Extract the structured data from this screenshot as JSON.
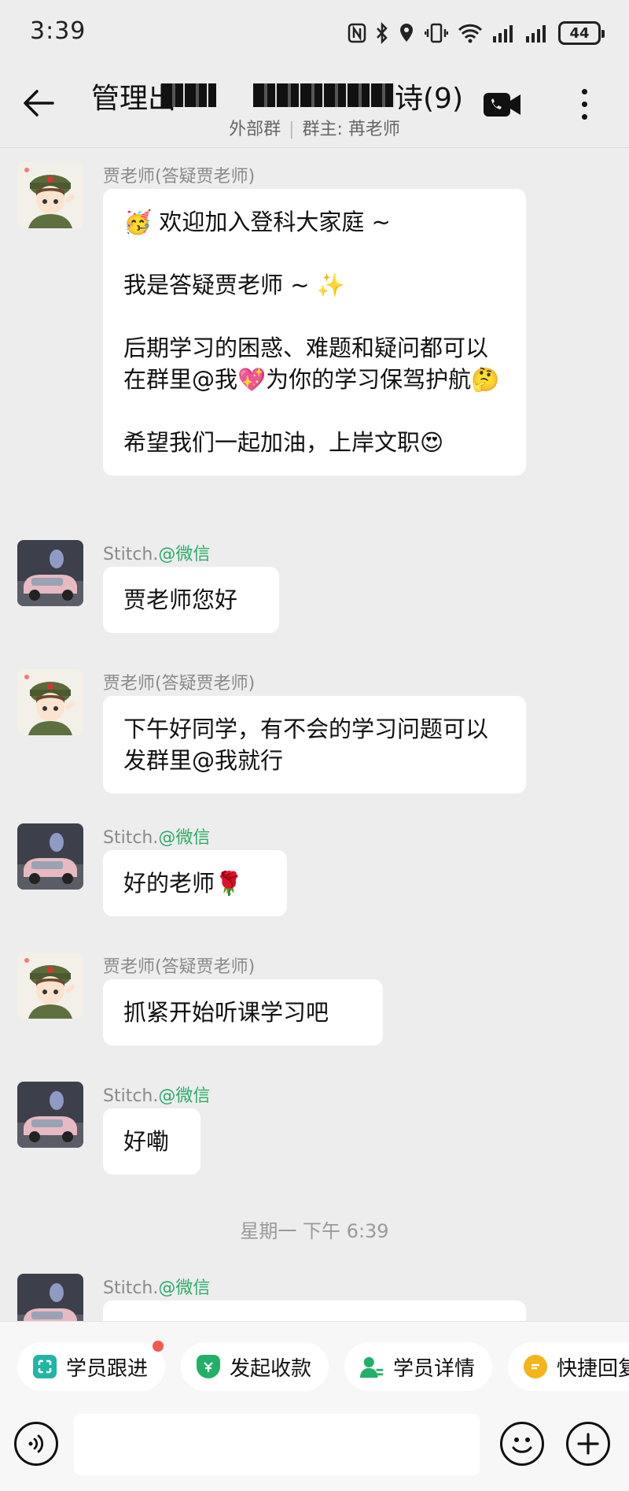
{
  "status_bar": {
    "time": "3:39",
    "battery": "44"
  },
  "header": {
    "title_prefix": "管理出",
    "title_suffix": "诗(9)",
    "subtitle_group_type": "外部群",
    "subtitle_owner": "群主: 苒老师"
  },
  "messages": [
    {
      "sender": "贾老师(答疑贾老师)",
      "tag": "",
      "avatar": "teacher",
      "paragraphs": [
        "🥳 欢迎加入登科大家庭 ~",
        "我是答疑贾老师 ~ ✨",
        "后期学习的困惑、难题和疑问都可以在群里@我💖为你的学习保驾护航🤔",
        "希望我们一起加油，上岸文职😍"
      ]
    },
    {
      "sender": "Stitch.",
      "tag": "@微信",
      "avatar": "student",
      "paragraphs": [
        "贾老师您好"
      ]
    },
    {
      "sender": "贾老师(答疑贾老师)",
      "tag": "",
      "avatar": "teacher",
      "paragraphs": [
        "下午好同学，有不会的学习问题可以发群里@我就行"
      ]
    },
    {
      "sender": "Stitch.",
      "tag": "@微信",
      "avatar": "student",
      "paragraphs": [
        "好的老师🌹"
      ]
    },
    {
      "sender": "贾老师(答疑贾老师)",
      "tag": "",
      "avatar": "teacher",
      "paragraphs": [
        "抓紧开始听课学习吧"
      ]
    },
    {
      "sender": "Stitch.",
      "tag": "@微信",
      "avatar": "student",
      "paragraphs": [
        "好嘞"
      ]
    },
    {
      "sender": "Stitch.",
      "tag": "@微信",
      "avatar": "student",
      "paragraphs": [
        ""
      ]
    }
  ],
  "timestamp": "星期一 下午 6:39",
  "quick_actions": [
    {
      "label": "学员跟进",
      "icon": "follow-up-icon",
      "color": "#22b5a6",
      "badge": true
    },
    {
      "label": "发起收款",
      "icon": "payment-shield-icon",
      "color": "#22b069",
      "badge": false
    },
    {
      "label": "学员详情",
      "icon": "user-detail-icon",
      "color": "#22b069",
      "badge": false
    },
    {
      "label": "快捷回复",
      "icon": "quick-reply-icon",
      "color": "#f4b41a",
      "badge": false
    }
  ],
  "input": {
    "placeholder": ""
  },
  "colors": {
    "background": "#ededed",
    "bubble": "#ffffff",
    "accent_green": "#2aae67",
    "badge_red": "#f25a4d"
  }
}
